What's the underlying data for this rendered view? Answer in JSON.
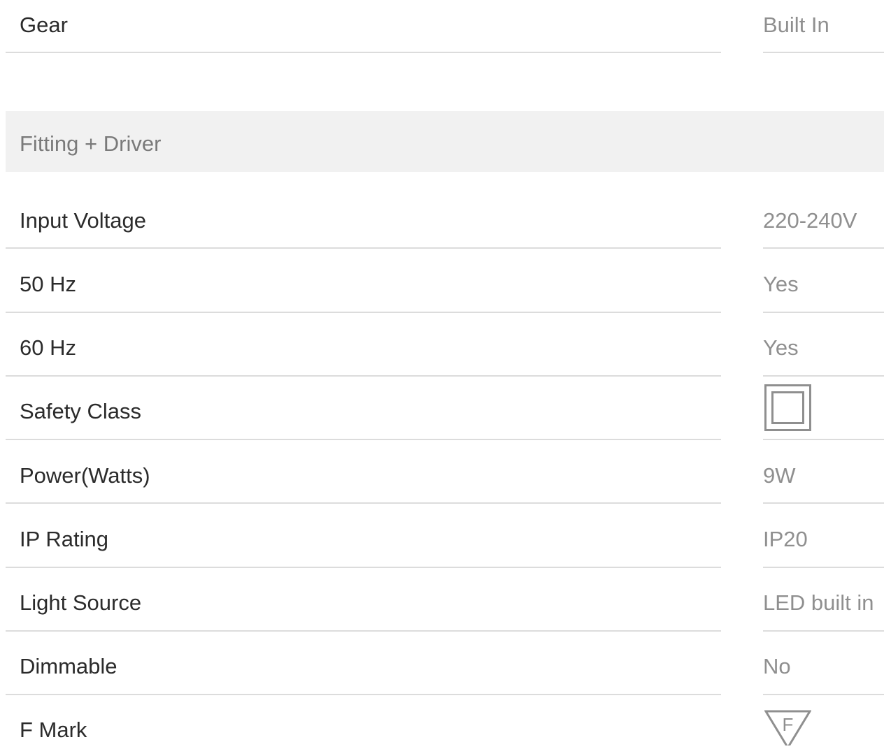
{
  "top_row": {
    "label": "Gear",
    "value": "Built In"
  },
  "section": {
    "title": "Fitting + Driver"
  },
  "rows": [
    {
      "label": "Input Voltage",
      "value": "220-240V"
    },
    {
      "label": "50 Hz",
      "value": "Yes"
    },
    {
      "label": "60 Hz",
      "value": "Yes"
    },
    {
      "label": "Safety Class",
      "icon": "class-ii-double-square-icon"
    },
    {
      "label": "Power(Watts)",
      "value": "9W"
    },
    {
      "label": "IP Rating",
      "value": "IP20"
    },
    {
      "label": "Light Source",
      "value": "LED built in"
    },
    {
      "label": "Dimmable",
      "value": "No"
    },
    {
      "label": "F Mark",
      "icon": "f-mark-triangle-icon",
      "icon_text": "F"
    }
  ],
  "colors": {
    "label_text": "#2b2b2b",
    "value_text": "#8f8f8f",
    "section_bg": "#f1f1f1",
    "divider": "#dcdcdc",
    "icon_stroke": "#8f8f8f"
  }
}
